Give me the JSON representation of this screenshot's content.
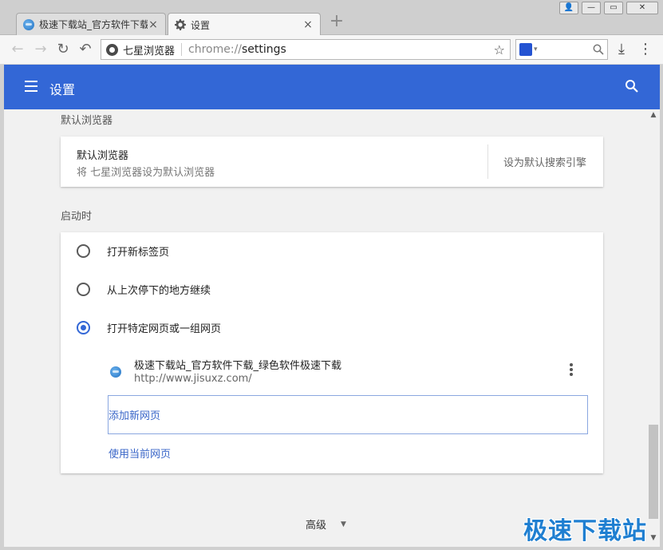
{
  "tabs": [
    {
      "title": "极速下载站_官方软件下载",
      "close": "×",
      "icon": "globe-favicon"
    },
    {
      "title": "设置",
      "close": "×",
      "icon": "gear-icon"
    }
  ],
  "new_tab": "+",
  "window_buttons": {
    "user": "👤",
    "minimize": "—",
    "restore": "▭",
    "close": "✕"
  },
  "toolbar": {
    "back": "←",
    "forward": "→",
    "reload": "↻",
    "undo": "↶",
    "site_name": "七星浏览器",
    "url_scheme": "chrome://",
    "url_path": "settings",
    "star": "☆",
    "search_placeholder": "",
    "download": "⤓",
    "menu": "⋮"
  },
  "header": {
    "title": "设置"
  },
  "default_browser": {
    "section_title": "默认浏览器",
    "row_title": "默认浏览器",
    "row_subtitle": "将 七星浏览器设为默认浏览器",
    "button": "设为默认搜索引擎"
  },
  "startup": {
    "section_title": "启动时",
    "options": [
      {
        "label": "打开新标签页",
        "checked": false
      },
      {
        "label": "从上次停下的地方继续",
        "checked": false
      },
      {
        "label": "打开特定网页或一组网页",
        "checked": true
      }
    ],
    "pages": [
      {
        "title": "极速下载站_官方软件下载_绿色软件极速下载",
        "url": "http://www.jisuxz.com/"
      }
    ],
    "add_page": "添加新网页",
    "use_current": "使用当前网页"
  },
  "advanced": {
    "label": "高级",
    "caret": "▼"
  },
  "watermark": "极速下载站",
  "colors": {
    "accent": "#3367d6",
    "link": "#3a66c8"
  }
}
